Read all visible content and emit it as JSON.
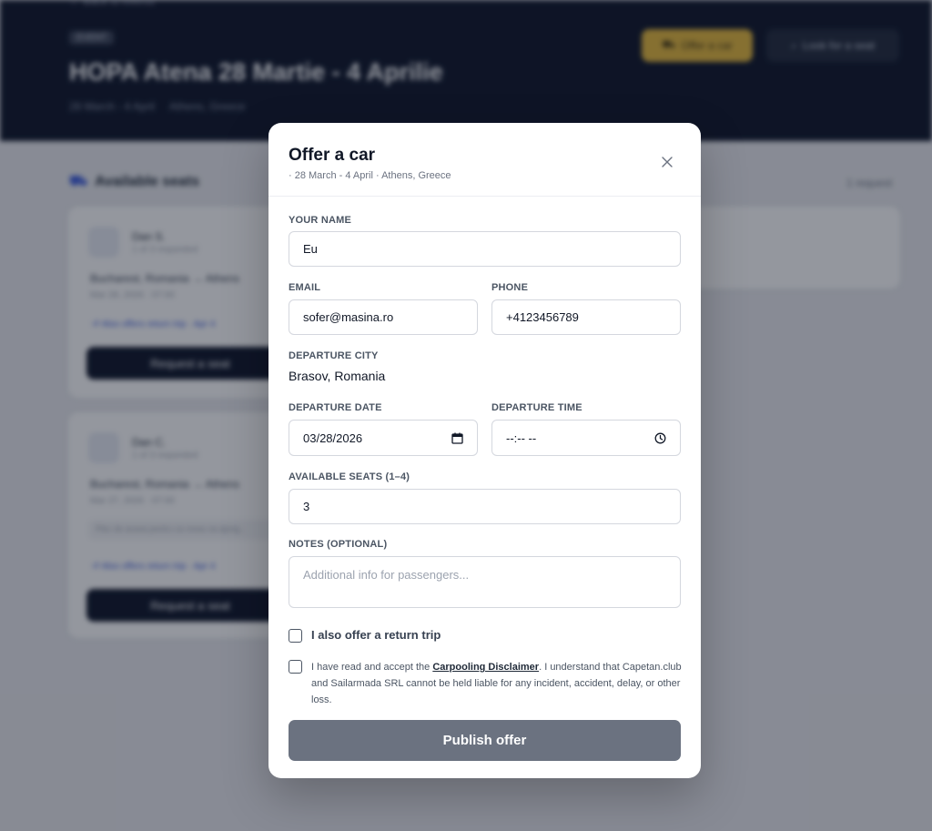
{
  "background": {
    "back_link": "← Back to events",
    "tag": "EVENT",
    "event_title": "HOPA Atena 28 Martie - 4 Aprilie",
    "event_dates": "28 March - 4 April",
    "event_location": "Athens, Greece",
    "offer_button": "Offer a car",
    "look_button": "Look for a seat",
    "available_seats_heading": "Available seats",
    "available_count": "1 request",
    "cards": [
      {
        "name": "Dan S.",
        "sub": "1 of 3 requested",
        "route": "Bucharest, Romania → Athens",
        "date": "Mar 28, 2026 · 07:00",
        "link": "↺ Also offers return trip · Apr 4",
        "button": "Request a seat"
      },
      {
        "name": "Dan C.",
        "sub": "1 of 3 requested",
        "route": "Bucharest, Romania → Athens",
        "date": "Mar 27, 2026 · 07:00",
        "note": "Plec de acasa pentru ca vreau sa ajung...",
        "link": "↺ Also offers return trip · Apr 4",
        "button": "Request a seat"
      }
    ]
  },
  "modal": {
    "title": "Offer a car",
    "subtitle": "· 28 March - 4 April · Athens, Greece",
    "name_label": "YOUR NAME",
    "name_value": "Eu",
    "email_label": "EMAIL",
    "email_value": "sofer@masina.ro",
    "phone_label": "PHONE",
    "phone_value": "+4123456789",
    "city_label": "DEPARTURE CITY",
    "city_value": "Brasov, Romania",
    "date_label": "DEPARTURE DATE",
    "date_value": "03/28/2026",
    "time_label": "DEPARTURE TIME",
    "time_value": "--:-- --",
    "seats_label": "AVAILABLE SEATS (1–4)",
    "seats_value": "3",
    "notes_label": "NOTES (OPTIONAL)",
    "notes_placeholder": "Additional info for passengers...",
    "return_trip_label": "I also offer a return trip",
    "disclaimer_prefix": "I have read and accept the ",
    "disclaimer_link": "Carpooling Disclaimer",
    "disclaimer_suffix": ". I understand that Capetan.club and Sailarmada SRL cannot be held liable for any incident, accident, delay, or other loss.",
    "publish_button": "Publish offer"
  },
  "colors": {
    "hero_bg": "#0b1226",
    "accent_yellow": "#e5b83a",
    "publish_disabled": "#6b7280"
  }
}
